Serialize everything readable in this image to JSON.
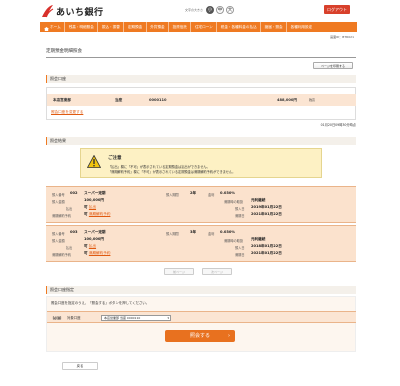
{
  "header": {
    "bank_name": "あいち銀行",
    "font_size_label": "文字の大きさ",
    "font_sizes": [
      "小",
      "中",
      "大"
    ],
    "logout_label": "ログアウト"
  },
  "nav": [
    "ホーム",
    "残高・明細照会",
    "振込・振替",
    "定期預金",
    "外貨預金",
    "投資信託",
    "住宅ローン",
    "税金・各種料金の払込",
    "諸届・照会",
    "各種利用設定"
  ],
  "screen_id": "画面ID：BTR021",
  "page_title": "定期預金明細照会",
  "print_label": "ページを印刷する",
  "account_section": {
    "heading": "照会口座",
    "branch": "本店営業部",
    "type": "当座",
    "number": "0000110",
    "balance": "488,000円",
    "balance_suffix": "残高",
    "change_link": "照会口座を変更する"
  },
  "timestamp": "01月20日09時30分時点",
  "results_section": {
    "heading": "照会結果"
  },
  "caution": {
    "title": "ご注意",
    "lines": [
      "「払出」欄に「不可」が表示されている定期預金は払出ができません。",
      "「満期解約予約」欄に「不可」が表示されている定期預金は満期解約予約ができません。"
    ]
  },
  "deposits": [
    {
      "no_label": "預入番号",
      "no": "002",
      "product": "スーパー定期",
      "amount_label": "預入金額",
      "amount": "100,000円",
      "withdraw_label": "払出",
      "withdraw": "可",
      "withdraw_link": "払出",
      "reserve_label": "満期解約予約",
      "reserve": "可",
      "reserve_link": "満期解約予約",
      "term_label": "預入期間",
      "term": "2年",
      "rate_label": "金利",
      "rate": "0.030%",
      "method_label": "満期時の取扱",
      "method": "元利継続",
      "start_label": "預入日",
      "start": "2019年01月22日",
      "maturity_label": "満期日",
      "maturity": "2021年01月22日"
    },
    {
      "no_label": "預入番号",
      "no": "003",
      "product": "スーパー定期",
      "amount_label": "預入金額",
      "amount": "100,000円",
      "withdraw_label": "払出",
      "withdraw": "可",
      "withdraw_link": "払出",
      "reserve_label": "満期解約予約",
      "reserve": "可",
      "reserve_link": "満期解約予約",
      "term_label": "預入期間",
      "term": "3年",
      "rate_label": "金利",
      "rate": "0.030%",
      "method_label": "満期時の取扱",
      "method": "元利継続",
      "start_label": "預入日",
      "start": "2018年01月22日",
      "maturity_label": "満期日",
      "maturity": "2021年01月22日"
    }
  ],
  "pager": {
    "prev": "前ページ",
    "next": "次ページ"
  },
  "select_section": {
    "heading": "照会口座指定",
    "note": "照会口座を指定のうえ、「照会する」ボタンを押してください。",
    "required": "【必須】",
    "field_label": "対象口座",
    "selected": "本店営業部 当座 0000110",
    "submit_label": "照会する"
  },
  "back_label": "戻る",
  "colors": {
    "accent": "#ef7a22",
    "highlight": "#fbe5d3",
    "logout": "#d8402b"
  }
}
